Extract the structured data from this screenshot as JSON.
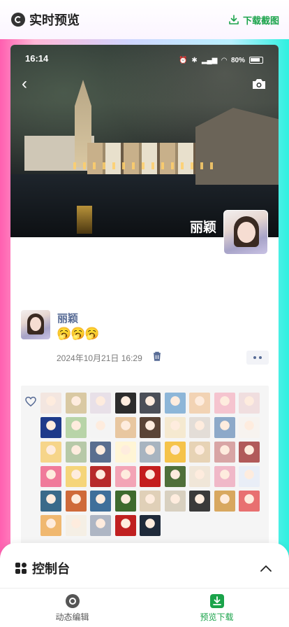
{
  "header": {
    "title": "实时预览",
    "download_label": "下载截图"
  },
  "status_bar": {
    "time": "16:14",
    "battery": "80%"
  },
  "cover": {
    "name": "丽颖"
  },
  "post": {
    "name": "丽颖",
    "emoji": "🥱🥱🥱",
    "time": "2024年10月21日 16:29"
  },
  "likes": {
    "colors": [
      "#f3e6e0",
      "#d9c9a3",
      "#e8e0e8",
      "#2c2c2c",
      "#4b4f58",
      "#8db6d8",
      "#f2d3b4",
      "#f5c4cf",
      "#f0dedf",
      "#1e3a8a",
      "#b8d4a8",
      "#f4f4f4",
      "#e8c7a0",
      "#5a4436",
      "#f5e9d0",
      "#e3ddd7",
      "#8da9c9",
      "#f7f3ef",
      "#f6d58a",
      "#b7c9a8",
      "#5a6e8f",
      "#fff5d6",
      "#a8b4c0",
      "#f5c34a",
      "#e7d3b5",
      "#d8a5a5",
      "#b15a5a",
      "#f07a9a",
      "#f5d57a",
      "#b72a2a",
      "#f3a4b6",
      "#c41e1e",
      "#4f6f3a",
      "#f0e6d8",
      "#f0b8c8",
      "#e9eef7",
      "#3a6a8a",
      "#cf6a3a",
      "#3f6f9a",
      "#3e6a2e",
      "#e0d0b8",
      "#d8d0c0",
      "#3a3a3a",
      "#d8a860",
      "#e87070",
      "#f0b870",
      "#f5efe5",
      "#aeb6c4",
      "#c02020",
      "#1f2a3a"
    ]
  },
  "console": {
    "title": "控制台"
  },
  "tabbar": {
    "tabs": [
      {
        "label": "动态编辑",
        "color": "#555555"
      },
      {
        "label": "预览下载",
        "color": "#1aa34a"
      }
    ]
  }
}
